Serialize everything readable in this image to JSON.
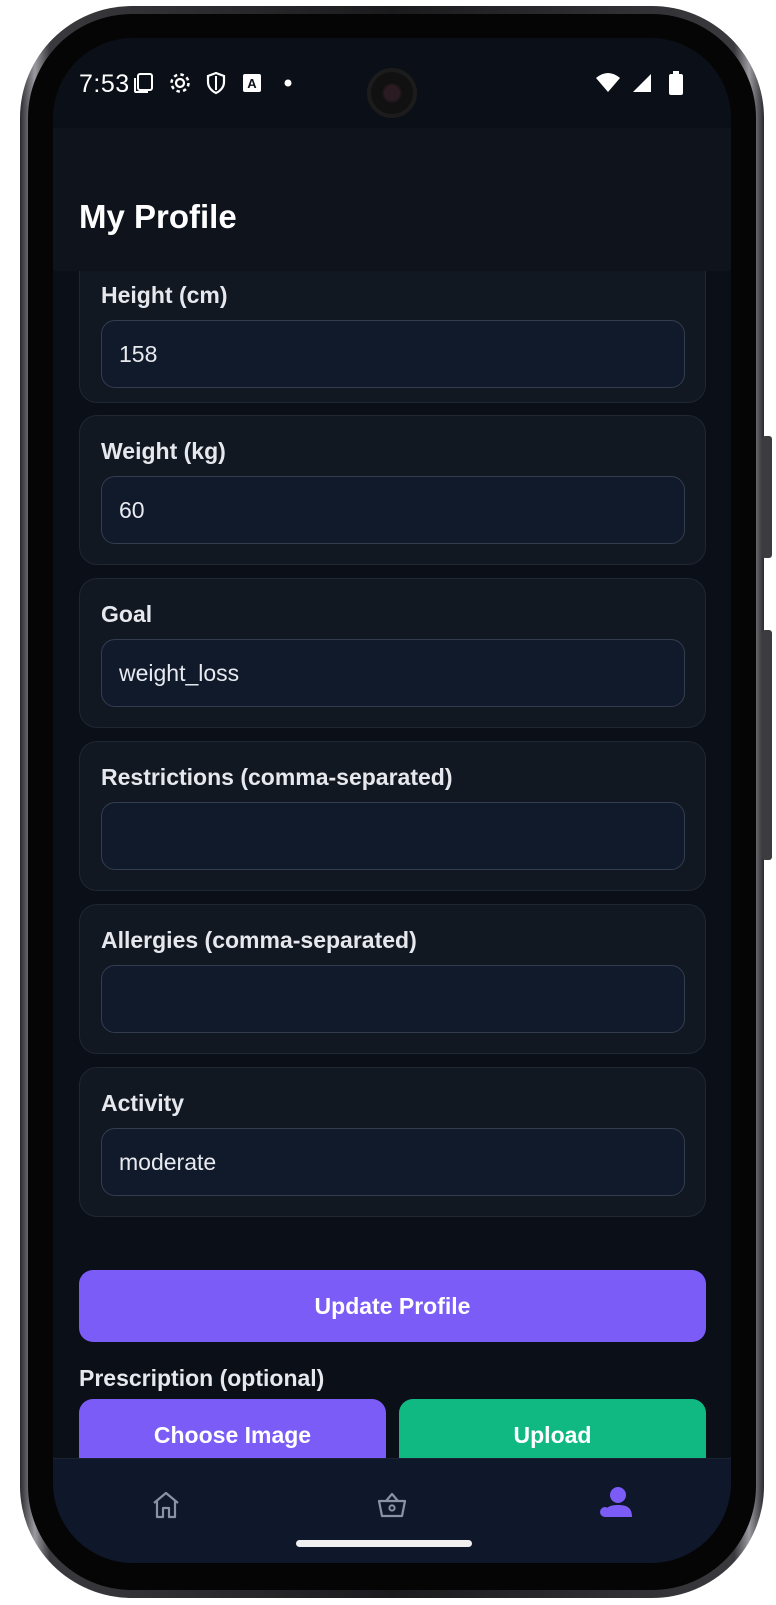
{
  "status_bar": {
    "time": "7:53",
    "left_icons": [
      "screenshot-icon",
      "settings-icon",
      "shield-icon",
      "keyboard-icon",
      "dot-icon"
    ],
    "right_icons": [
      "wifi-icon",
      "signal-icon",
      "battery-icon"
    ]
  },
  "header": {
    "title": "My Profile"
  },
  "fields": [
    {
      "label": "Height (cm)",
      "value": "158"
    },
    {
      "label": "Weight (kg)",
      "value": "60"
    },
    {
      "label": "Goal",
      "value": "weight_loss"
    },
    {
      "label": "Restrictions (comma-separated)",
      "value": ""
    },
    {
      "label": "Allergies (comma-separated)",
      "value": ""
    },
    {
      "label": "Activity",
      "value": "moderate"
    }
  ],
  "actions": {
    "update_label": "Update Profile",
    "prescription_label": "Prescription (optional)",
    "choose_label": "Choose Image",
    "upload_label": "Upload"
  },
  "bottom_nav": {
    "items": [
      {
        "icon": "home-icon",
        "active": false
      },
      {
        "icon": "basket-icon",
        "active": false
      },
      {
        "icon": "profile-icon",
        "active": true
      }
    ]
  },
  "colors": {
    "accent": "#7b5cf6",
    "upload": "#10b981",
    "background": "#0b0f17",
    "card": "#121821",
    "input": "#111a2b"
  }
}
